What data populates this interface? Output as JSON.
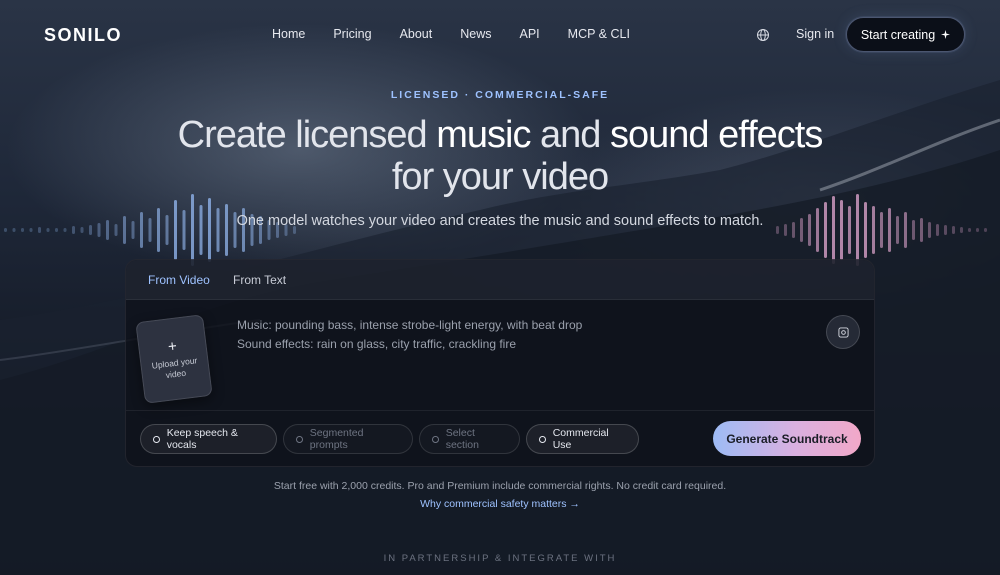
{
  "nav": {
    "logo": "SONILO",
    "links": [
      "Home",
      "Pricing",
      "About",
      "News",
      "API",
      "MCP & CLI"
    ],
    "signin": "Sign in",
    "cta": "Start creating",
    "cta_icon": "sparkle-icon",
    "language_icon": "globe-icon"
  },
  "hero": {
    "eyebrow": "LICENSED · COMMERCIAL-SAFE",
    "title_part1": "Create licensed ",
    "title_part2": "music",
    "title_part3": " and ",
    "title_part4": "sound effects",
    "title_line2": "for your video",
    "subtitle": "One model watches your video and creates the music and sound effects to match."
  },
  "card": {
    "tabs": [
      "From Video",
      "From Text"
    ],
    "active_tab": "From Video",
    "upload_label": "Upload your video",
    "prompt_line1": "Music: pounding bass, intense strobe-light energy, with beat drop",
    "prompt_line2": "Sound effects: rain on glass, city traffic, crackling fire",
    "image_button_icon": "image-icon",
    "chips": [
      "Keep speech & vocals",
      "Segmented prompts",
      "Select section",
      "Commercial Use"
    ],
    "generate": "Generate Soundtrack"
  },
  "footer": {
    "note": "Start free with 2,000 credits. Pro and Premium include commercial rights. No credit card required.",
    "why_link": "Why commercial safety matters →",
    "partner": "IN PARTNERSHIP & INTEGRATE WITH"
  },
  "colors": {
    "accent": "#9ec2ff",
    "generate_gradient_start": "#9dbbf5",
    "generate_gradient_end": "#f2a8c8",
    "wave_left": "#8fb2e8",
    "wave_right": "#d8a0c8"
  }
}
